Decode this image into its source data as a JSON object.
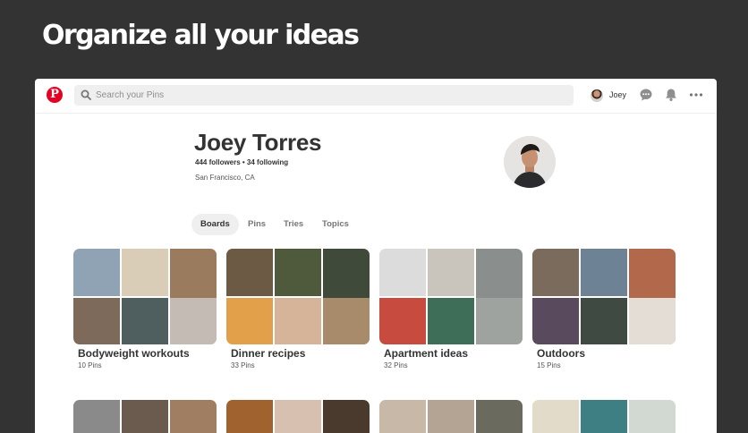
{
  "headline": "Organize all your ideas",
  "topbar": {
    "search_placeholder": "Search your Pins",
    "username": "Joey"
  },
  "profile": {
    "name": "Joey Torres",
    "stats": "444 followers • 34 following",
    "location": "San Francisco, CA"
  },
  "tabs": [
    {
      "label": "Boards",
      "active": true
    },
    {
      "label": "Pins",
      "active": false
    },
    {
      "label": "Tries",
      "active": false
    },
    {
      "label": "Topics",
      "active": false
    }
  ],
  "boards": [
    {
      "title": "Bodyweight workouts",
      "count": "10 Pins",
      "colors": [
        "#8fa3b5",
        "#d9cdb8",
        "#9a7b5e",
        "#7e6a5a",
        "#4f5e5f",
        "#c4bcb4"
      ]
    },
    {
      "title": "Dinner recipes",
      "count": "33 Pins",
      "colors": [
        "#6d5a44",
        "#4f5a3c",
        "#3f4a3a",
        "#e3a04a",
        "#d6b49a",
        "#a88b6a"
      ]
    },
    {
      "title": "Apartment ideas",
      "count": "32 Pins",
      "colors": [
        "#dcdcdc",
        "#c9c4bc",
        "#8a8f8d",
        "#c84b3f",
        "#3f6e58",
        "#9fa3a0"
      ]
    },
    {
      "title": "Outdoors",
      "count": "15 Pins",
      "colors": [
        "#7b6b5c",
        "#6e8296",
        "#b2684a",
        "#5a4a5e",
        "#3e4a42",
        "#e3ddd5"
      ]
    }
  ],
  "boards_row2": [
    {
      "colors": [
        "#8a8a8a",
        "#6b5a4e",
        "#a07e62"
      ]
    },
    {
      "colors": [
        "#a0622f",
        "#d8c0b0",
        "#4a3a2e"
      ]
    },
    {
      "colors": [
        "#c8b8a8",
        "#b4a494",
        "#6a6a5e"
      ]
    },
    {
      "colors": [
        "#e3dbc9",
        "#3e7f84",
        "#d2d8d2"
      ]
    }
  ],
  "accent": "#e60023"
}
